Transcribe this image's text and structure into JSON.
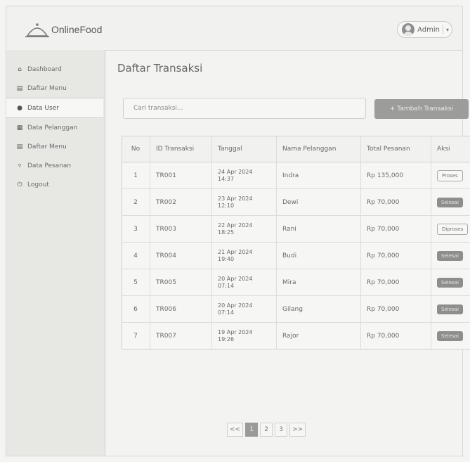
{
  "header": {
    "app_name": "OnlineFood",
    "user": "Admin"
  },
  "sidebar": {
    "items": [
      {
        "label": "Dashboard",
        "icon": "home-icon"
      },
      {
        "label": "Daftar Menu",
        "icon": "menu-icon"
      },
      {
        "label": "Data User",
        "icon": "user-icon"
      },
      {
        "label": "Data Pelanggan",
        "icon": "customers-icon"
      },
      {
        "label": "Daftar Menu",
        "icon": "menu-icon"
      },
      {
        "label": "Data Pesanan",
        "icon": "cart-icon"
      },
      {
        "label": "Logout",
        "icon": "power-icon"
      }
    ]
  },
  "main": {
    "title": "Daftar Transaksi",
    "search_placeholder": "Cari transaksi...",
    "add_button": "+ Tambah Transaksi",
    "columns": [
      "No",
      "ID Transaksi",
      "Tanggal",
      "Nama Pelanggan",
      "Total Pesanan",
      "Aksi"
    ],
    "rows": [
      {
        "no": "1",
        "id": "TR001",
        "date": "24 Apr 2024",
        "time": "14:37",
        "name": "Indra",
        "total": "Rp 135,000",
        "action": "Proses",
        "style": "outline"
      },
      {
        "no": "2",
        "id": "TR002",
        "date": "23 Apr 2024",
        "time": "12:10",
        "name": "Dewi",
        "total": "Rp 70,000",
        "action": "Selesai",
        "style": "solid"
      },
      {
        "no": "3",
        "id": "TR003",
        "date": "22 Apr 2024",
        "time": "18:25",
        "name": "Rani",
        "total": "Rp 70,000",
        "action": "Diproses",
        "style": "outline"
      },
      {
        "no": "4",
        "id": "TR004",
        "date": "21 Apr 2024",
        "time": "19:40",
        "name": "Budi",
        "total": "Rp 70,000",
        "action": "Selesai",
        "style": "solid"
      },
      {
        "no": "5",
        "id": "TR005",
        "date": "20 Apr 2024",
        "time": "07:14",
        "name": "Mira",
        "total": "Rp 70,000",
        "action": "Selesai",
        "style": "solid"
      },
      {
        "no": "6",
        "id": "TR006",
        "date": "20 Apr 2024",
        "time": "07:14",
        "name": "Gilang",
        "total": "Rp 70,000",
        "action": "Selesai",
        "style": "solid"
      },
      {
        "no": "7",
        "id": "TR007",
        "date": "19 Apr 2024",
        "time": "19:26",
        "name": "Rajor",
        "total": "Rp 70,000",
        "action": "Selesai",
        "style": "solid"
      }
    ],
    "pagination": {
      "prev": "<<",
      "pages": [
        "1",
        "2",
        "3"
      ],
      "next": ">>",
      "current": "1"
    }
  }
}
